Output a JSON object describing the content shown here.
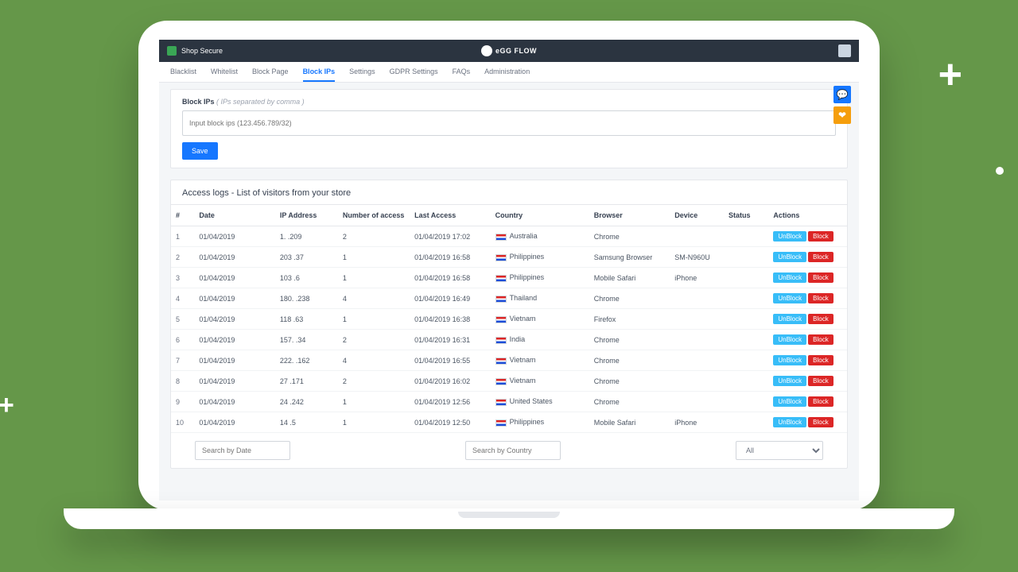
{
  "topbar": {
    "app_name": "Shop Secure",
    "logo_text": "eGG FLOW"
  },
  "tabs": [
    {
      "label": "Blacklist"
    },
    {
      "label": "Whitelist"
    },
    {
      "label": "Block Page"
    },
    {
      "label": "Block IPs",
      "active": true
    },
    {
      "label": "Settings"
    },
    {
      "label": "GDPR Settings"
    },
    {
      "label": "FAQs"
    },
    {
      "label": "Administration"
    }
  ],
  "block_panel": {
    "label_bold": "Block IPs",
    "label_hint": "( IPs separated by comma )",
    "placeholder": "Input block ips (123.456.789/32)",
    "save_label": "Save"
  },
  "log_section": {
    "title": "Access logs - List of visitors from your store"
  },
  "columns": {
    "idx": "#",
    "date": "Date",
    "ip": "IP Address",
    "num": "Number of access",
    "last": "Last Access",
    "country": "Country",
    "browser": "Browser",
    "device": "Device",
    "status": "Status",
    "actions": "Actions"
  },
  "action_labels": {
    "unblock": "UnBlock",
    "block": "Block"
  },
  "rows": [
    {
      "idx": "1",
      "date": "01/04/2019",
      "ip": "1.      .209",
      "num": "2",
      "last": "01/04/2019 17:02",
      "country": "Australia",
      "browser": "Chrome",
      "device": "",
      "status": ""
    },
    {
      "idx": "2",
      "date": "01/04/2019",
      "ip": "203       .37",
      "num": "1",
      "last": "01/04/2019 16:58",
      "country": "Philippines",
      "browser": "Samsung Browser",
      "device": "SM-N960U",
      "status": ""
    },
    {
      "idx": "3",
      "date": "01/04/2019",
      "ip": "103         .6",
      "num": "1",
      "last": "01/04/2019 16:58",
      "country": "Philippines",
      "browser": "Mobile Safari",
      "device": "iPhone",
      "status": ""
    },
    {
      "idx": "4",
      "date": "01/04/2019",
      "ip": "180.      .238",
      "num": "4",
      "last": "01/04/2019 16:49",
      "country": "Thailand",
      "browser": "Chrome",
      "device": "",
      "status": ""
    },
    {
      "idx": "5",
      "date": "01/04/2019",
      "ip": "118     .63",
      "num": "1",
      "last": "01/04/2019 16:38",
      "country": "Vietnam",
      "browser": "Firefox",
      "device": "",
      "status": ""
    },
    {
      "idx": "6",
      "date": "01/04/2019",
      "ip": "157.     .34",
      "num": "2",
      "last": "01/04/2019 16:31",
      "country": "India",
      "browser": "Chrome",
      "device": "",
      "status": ""
    },
    {
      "idx": "7",
      "date": "01/04/2019",
      "ip": "222.     .162",
      "num": "4",
      "last": "01/04/2019 16:55",
      "country": "Vietnam",
      "browser": "Chrome",
      "device": "",
      "status": ""
    },
    {
      "idx": "8",
      "date": "01/04/2019",
      "ip": "27      .171",
      "num": "2",
      "last": "01/04/2019 16:02",
      "country": "Vietnam",
      "browser": "Chrome",
      "device": "",
      "status": ""
    },
    {
      "idx": "9",
      "date": "01/04/2019",
      "ip": "24     .242",
      "num": "1",
      "last": "01/04/2019 12:56",
      "country": "United States",
      "browser": "Chrome",
      "device": "",
      "status": ""
    },
    {
      "idx": "10",
      "date": "01/04/2019",
      "ip": "14     .5",
      "num": "1",
      "last": "01/04/2019 12:50",
      "country": "Philippines",
      "browser": "Mobile Safari",
      "device": "iPhone",
      "status": ""
    }
  ],
  "filters": {
    "date_placeholder": "Search by Date",
    "country_placeholder": "Search by Country",
    "status_all": "All"
  },
  "float": {
    "chat": "💬",
    "heart": "❤"
  }
}
